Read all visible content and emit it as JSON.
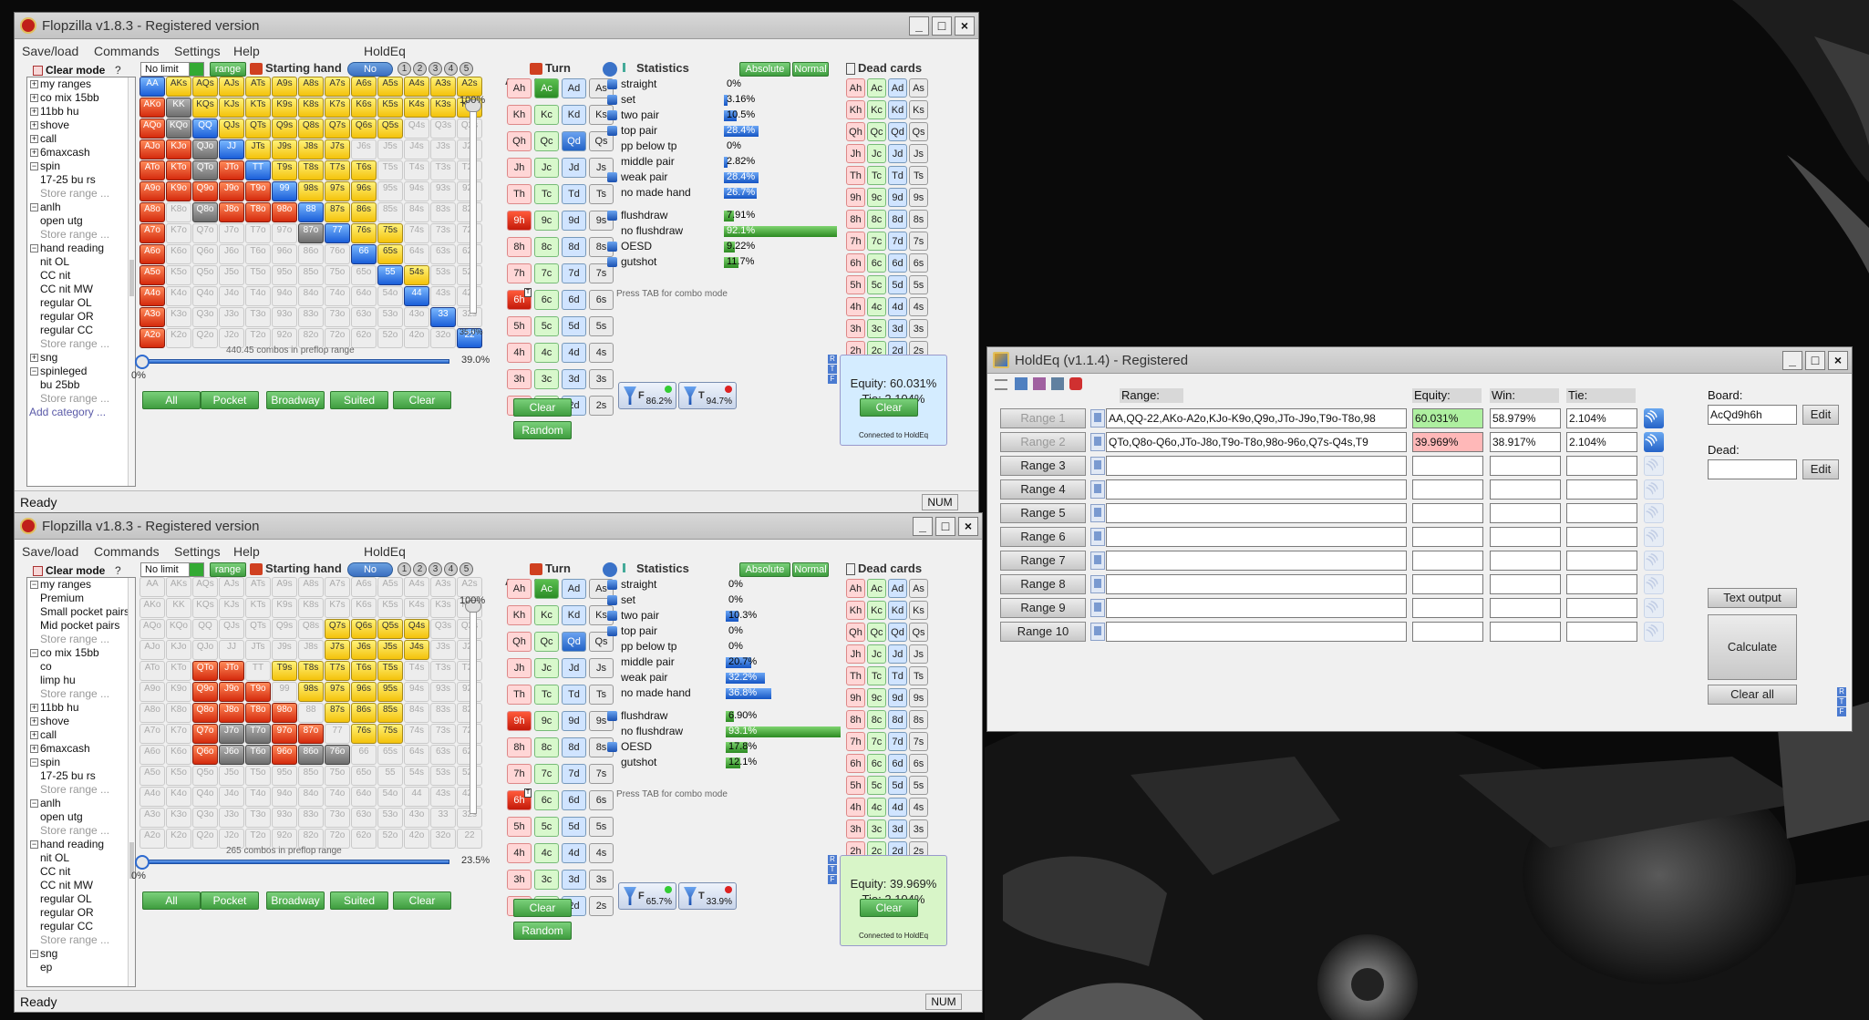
{
  "flopzilla_top": {
    "title": "Flopzilla v1.8.3 - Registered version",
    "menu": [
      "Save/load",
      "Commands",
      "Settings",
      "Help",
      "HoldEq"
    ],
    "clear_mode": "Clear mode",
    "tree": [
      {
        "k": "c",
        "t": "my ranges"
      },
      {
        "k": "c",
        "t": "co mix 15bb"
      },
      {
        "k": "c",
        "t": "11bb hu"
      },
      {
        "k": "c",
        "t": "shove"
      },
      {
        "k": "c",
        "t": "call"
      },
      {
        "k": "c",
        "t": "6maxcash"
      },
      {
        "k": "o",
        "t": "spin"
      },
      {
        "k": "i",
        "t": "17-25 bu rs"
      },
      {
        "k": "s",
        "t": "Store range ..."
      },
      {
        "k": "o",
        "t": "anlh"
      },
      {
        "k": "i",
        "t": "open utg"
      },
      {
        "k": "s",
        "t": "Store range ..."
      },
      {
        "k": "o",
        "t": "hand reading"
      },
      {
        "k": "i",
        "t": "nit OL"
      },
      {
        "k": "i",
        "t": "CC nit"
      },
      {
        "k": "i",
        "t": "CC nit MW"
      },
      {
        "k": "i",
        "t": "regular OL"
      },
      {
        "k": "i",
        "t": "regular OR"
      },
      {
        "k": "i",
        "t": "regular CC"
      },
      {
        "k": "s",
        "t": "Store range ..."
      },
      {
        "k": "c",
        "t": "sng"
      },
      {
        "k": "o",
        "t": "spinleged"
      },
      {
        "k": "i",
        "t": "bu 25bb"
      },
      {
        "k": "s",
        "t": "Store range ..."
      },
      {
        "k": "a",
        "t": "Add category ..."
      }
    ],
    "limit": "No limit",
    "range_btn": "range",
    "starting_hand": "Starting hand",
    "no_weight": "No weight",
    "pct_top": "100%",
    "pct_mid": "35.0%",
    "pct_zero": "0%",
    "pct_slider": "39.0%",
    "combos": "440.45 combos in preflop range",
    "buttons": [
      "All",
      "Pocket",
      "Broadway",
      "Suited",
      "Clear"
    ],
    "turn_title": "Turn",
    "turn_buttons": [
      "Clear",
      "Random"
    ],
    "stats_title": "Statistics",
    "absolute": "Absolute",
    "normal": "Normal",
    "stats": [
      {
        "n": "straight",
        "f": true,
        "v": "0%",
        "p": 0,
        "c": "bl"
      },
      {
        "n": "set",
        "f": true,
        "v": "3.16%",
        "p": 3.16,
        "c": "bl"
      },
      {
        "n": "two pair",
        "f": true,
        "v": "10.5%",
        "p": 10.5,
        "c": "bl"
      },
      {
        "n": "top pair",
        "f": true,
        "v": "28.4%",
        "p": 28.4,
        "c": "bl"
      },
      {
        "n": "pp below tp",
        "f": false,
        "v": "0%",
        "p": 0,
        "c": "bl"
      },
      {
        "n": "middle pair",
        "f": false,
        "v": "2.82%",
        "p": 2.82,
        "c": "bl"
      },
      {
        "n": "weak pair",
        "f": true,
        "v": "28.4%",
        "p": 28.4,
        "c": "bl"
      },
      {
        "n": "no made hand",
        "f": false,
        "v": "26.7%",
        "p": 26.7,
        "c": "bl"
      },
      {
        "n": "flushdraw",
        "f": true,
        "v": "7.91%",
        "p": 7.91,
        "c": "gr",
        "gap": true
      },
      {
        "n": "no flushdraw",
        "f": false,
        "v": "92.1%",
        "p": 92.1,
        "c": "gr"
      },
      {
        "n": "OESD",
        "f": true,
        "v": "9.22%",
        "p": 9.22,
        "c": "gr"
      },
      {
        "n": "gutshot",
        "f": true,
        "v": "11.7%",
        "p": 11.7,
        "c": "gr"
      }
    ],
    "press_tab": "Press TAB for combo mode",
    "dead_title": "Dead cards",
    "equity": "Equity: 60.031%",
    "tie": "Tie: 2.104%",
    "connected": "Connected to HoldEq",
    "eq_clear": "Clear",
    "f_val": "86.2%",
    "t_val": "94.7%",
    "status": "Ready",
    "num": "NUM"
  },
  "flopzilla_bottom": {
    "title": "Flopzilla v1.8.3 - Registered version",
    "menu": [
      "Save/load",
      "Commands",
      "Settings",
      "Help",
      "HoldEq"
    ],
    "clear_mode": "Clear mode",
    "tree": [
      {
        "k": "o",
        "t": "my ranges"
      },
      {
        "k": "i",
        "t": "Premium"
      },
      {
        "k": "i",
        "t": "Small pocket pairs"
      },
      {
        "k": "i",
        "t": "Mid pocket pairs"
      },
      {
        "k": "s",
        "t": "Store range ..."
      },
      {
        "k": "o",
        "t": "co mix 15bb"
      },
      {
        "k": "i",
        "t": "co"
      },
      {
        "k": "i",
        "t": "limp hu"
      },
      {
        "k": "s",
        "t": "Store range ..."
      },
      {
        "k": "c",
        "t": "11bb hu"
      },
      {
        "k": "c",
        "t": "shove"
      },
      {
        "k": "c",
        "t": "call"
      },
      {
        "k": "c",
        "t": "6maxcash"
      },
      {
        "k": "o",
        "t": "spin"
      },
      {
        "k": "i",
        "t": "17-25 bu rs"
      },
      {
        "k": "s",
        "t": "Store range ..."
      },
      {
        "k": "o",
        "t": "anlh"
      },
      {
        "k": "i",
        "t": "open utg"
      },
      {
        "k": "s",
        "t": "Store range ..."
      },
      {
        "k": "o",
        "t": "hand reading"
      },
      {
        "k": "i",
        "t": "nit OL"
      },
      {
        "k": "i",
        "t": "CC nit"
      },
      {
        "k": "i",
        "t": "CC nit MW"
      },
      {
        "k": "i",
        "t": "regular OL"
      },
      {
        "k": "i",
        "t": "regular OR"
      },
      {
        "k": "i",
        "t": "regular CC"
      },
      {
        "k": "s",
        "t": "Store range ..."
      },
      {
        "k": "o",
        "t": "sng"
      },
      {
        "k": "i",
        "t": "ep"
      }
    ],
    "limit": "No limit",
    "range_btn": "range",
    "starting_hand": "Starting hand",
    "no_weight": "No weight",
    "pct_top": "100%",
    "pct_zero": "0%",
    "pct_slider": "23.5%",
    "combos": "265 combos in preflop range",
    "buttons": [
      "All",
      "Pocket",
      "Broadway",
      "Suited",
      "Clear"
    ],
    "turn_title": "Turn",
    "turn_buttons": [
      "Clear",
      "Random"
    ],
    "stats_title": "Statistics",
    "absolute": "Absolute",
    "normal": "Normal",
    "stats": [
      {
        "n": "straight",
        "f": true,
        "v": "0%",
        "p": 0,
        "c": "bl"
      },
      {
        "n": "set",
        "f": true,
        "v": "0%",
        "p": 0,
        "c": "bl"
      },
      {
        "n": "two pair",
        "f": true,
        "v": "10.3%",
        "p": 10.3,
        "c": "bl"
      },
      {
        "n": "top pair",
        "f": true,
        "v": "0%",
        "p": 0,
        "c": "bl"
      },
      {
        "n": "pp below tp",
        "f": false,
        "v": "0%",
        "p": 0,
        "c": "bl"
      },
      {
        "n": "middle pair",
        "f": false,
        "v": "20.7%",
        "p": 20.7,
        "c": "bl"
      },
      {
        "n": "weak pair",
        "f": false,
        "v": "32.2%",
        "p": 32.2,
        "c": "bl"
      },
      {
        "n": "no made hand",
        "f": false,
        "v": "36.8%",
        "p": 36.8,
        "c": "bl"
      },
      {
        "n": "flushdraw",
        "f": true,
        "v": "6.90%",
        "p": 6.9,
        "c": "gr",
        "gap": true
      },
      {
        "n": "no flushdraw",
        "f": false,
        "v": "93.1%",
        "p": 93.1,
        "c": "gr"
      },
      {
        "n": "OESD",
        "f": true,
        "v": "17.8%",
        "p": 17.8,
        "c": "gr"
      },
      {
        "n": "gutshot",
        "f": false,
        "v": "12.1%",
        "p": 12.1,
        "c": "gr"
      }
    ],
    "press_tab": "Press TAB for combo mode",
    "dead_title": "Dead cards",
    "equity": "Equity: 39.969%",
    "tie": "Tie: 2.104%",
    "connected": "Connected to HoldEq",
    "eq_clear": "Clear",
    "f_val": "65.7%",
    "t_val": "33.9%",
    "status": "Ready",
    "num": "NUM"
  },
  "grid_top": [
    [
      "b:AA",
      "y:AKs",
      "y:AQs",
      "y:AJs",
      "y:ATs",
      "y:A9s",
      "y:A8s",
      "y:A7s",
      "y:A6s",
      "y:A5s",
      "y:A4s",
      "y:A3s",
      "y:A2s"
    ],
    [
      "r:AKo",
      "g:KK",
      "y:KQs",
      "y:KJs",
      "y:KTs",
      "y:K9s",
      "y:K8s",
      "y:K7s",
      "y:K6s",
      "y:K5s",
      "y:K4s",
      "y:K3s",
      "y:K2s"
    ],
    [
      "r:AQo",
      "g:KQo",
      "b:QQ",
      "y:QJs",
      "y:QTs",
      "y:Q9s",
      "y:Q8s",
      "y:Q7s",
      "y:Q6s",
      "y:Q5s",
      "e:Q4s",
      "e:Q3s",
      "e:Q2s"
    ],
    [
      "r:AJo",
      "r:KJo",
      "g:QJo",
      "b:JJ",
      "y:JTs",
      "y:J9s",
      "y:J8s",
      "y:J7s",
      "e:J6s",
      "e:J5s",
      "e:J4s",
      "e:J3s",
      "e:J2s"
    ],
    [
      "r:ATo",
      "r:KTo",
      "g:QTo",
      "r:JTo",
      "b:TT",
      "y:T9s",
      "y:T8s",
      "y:T7s",
      "y:T6s",
      "e:T5s",
      "e:T4s",
      "e:T3s",
      "e:T2s"
    ],
    [
      "r:A9o",
      "r:K9o",
      "r:Q9o",
      "r:J9o",
      "r:T9o",
      "b:99",
      "y:98s",
      "y:97s",
      "y:96s",
      "e:95s",
      "e:94s",
      "e:93s",
      "e:92s"
    ],
    [
      "r:A8o",
      "e:K8o",
      "g:Q8o",
      "r:J8o",
      "r:T8o",
      "r:98o",
      "b:88",
      "y:87s",
      "y:86s",
      "e:85s",
      "e:84s",
      "e:83s",
      "e:82s"
    ],
    [
      "r:A7o",
      "e:K7o",
      "e:Q7o",
      "e:J7o",
      "e:T7o",
      "e:97o",
      "g:87o",
      "b:77",
      "y:76s",
      "y:75s",
      "e:74s",
      "e:73s",
      "e:72s"
    ],
    [
      "r:A6o",
      "e:K6o",
      "e:Q6o",
      "e:J6o",
      "e:T6o",
      "e:96o",
      "e:86o",
      "e:76o",
      "b:66",
      "y:65s",
      "e:64s",
      "e:63s",
      "e:62s"
    ],
    [
      "r:A5o",
      "e:K5o",
      "e:Q5o",
      "e:J5o",
      "e:T5o",
      "e:95o",
      "e:85o",
      "e:75o",
      "e:65o",
      "b:55",
      "y:54s",
      "e:53s",
      "e:52s"
    ],
    [
      "r:A4o",
      "e:K4o",
      "e:Q4o",
      "e:J4o",
      "e:T4o",
      "e:94o",
      "e:84o",
      "e:74o",
      "e:64o",
      "e:54o",
      "b:44",
      "e:43s",
      "e:42s"
    ],
    [
      "r:A3o",
      "e:K3o",
      "e:Q3o",
      "e:J3o",
      "e:T3o",
      "e:93o",
      "e:83o",
      "e:73o",
      "e:63o",
      "e:53o",
      "e:43o",
      "b:33",
      "e:32s"
    ],
    [
      "r:A2o",
      "e:K2o",
      "e:Q2o",
      "e:J2o",
      "e:T2o",
      "e:92o",
      "e:82o",
      "e:72o",
      "e:62o",
      "e:52o",
      "e:42o",
      "e:32o",
      "b:22"
    ]
  ],
  "grid_bottom": [
    [
      "e:AA",
      "e:AKs",
      "e:AQs",
      "e:AJs",
      "e:ATs",
      "e:A9s",
      "e:A8s",
      "e:A7s",
      "e:A6s",
      "e:A5s",
      "e:A4s",
      "e:A3s",
      "e:A2s"
    ],
    [
      "e:AKo",
      "e:KK",
      "e:KQs",
      "e:KJs",
      "e:KTs",
      "e:K9s",
      "e:K8s",
      "e:K7s",
      "e:K6s",
      "e:K5s",
      "e:K4s",
      "e:K3s",
      "e:K2s"
    ],
    [
      "e:AQo",
      "e:KQo",
      "e:QQ",
      "e:QJs",
      "e:QTs",
      "e:Q9s",
      "e:Q8s",
      "y:Q7s",
      "y:Q6s",
      "y:Q5s",
      "y:Q4s",
      "e:Q3s",
      "e:Q2s"
    ],
    [
      "e:AJo",
      "e:KJo",
      "e:QJo",
      "e:JJ",
      "e:JTs",
      "e:J9s",
      "e:J8s",
      "y:J7s",
      "y:J6s",
      "y:J5s",
      "y:J4s",
      "e:J3s",
      "e:J2s"
    ],
    [
      "e:ATo",
      "e:KTo",
      "r:QTo",
      "r:JTo",
      "e:TT",
      "y:T9s",
      "y:T8s",
      "y:T7s",
      "y:T6s",
      "y:T5s",
      "e:T4s",
      "e:T3s",
      "e:T2s"
    ],
    [
      "e:A9o",
      "e:K9o",
      "r:Q9o",
      "r:J9o",
      "r:T9o",
      "e:99",
      "y:98s",
      "y:97s",
      "y:96s",
      "y:95s",
      "e:94s",
      "e:93s",
      "e:92s"
    ],
    [
      "e:A8o",
      "e:K8o",
      "r:Q8o",
      "r:J8o",
      "r:T8o",
      "r:98o",
      "e:88",
      "y:87s",
      "y:86s",
      "y:85s",
      "e:84s",
      "e:83s",
      "e:82s"
    ],
    [
      "e:A7o",
      "e:K7o",
      "r:Q7o",
      "g:J7o",
      "g:T7o",
      "r:97o",
      "r:87o",
      "e:77",
      "y:76s",
      "y:75s",
      "e:74s",
      "e:73s",
      "e:72s"
    ],
    [
      "e:A6o",
      "e:K6o",
      "r:Q6o",
      "g:J6o",
      "g:T6o",
      "r:96o",
      "g:86o",
      "g:76o",
      "e:66",
      "e:65s",
      "e:64s",
      "e:63s",
      "e:62s"
    ],
    [
      "e:A5o",
      "e:K5o",
      "e:Q5o",
      "e:J5o",
      "e:T5o",
      "e:95o",
      "e:85o",
      "e:75o",
      "e:65o",
      "e:55",
      "e:54s",
      "e:53s",
      "e:52s"
    ],
    [
      "e:A4o",
      "e:K4o",
      "e:Q4o",
      "e:J4o",
      "e:T4o",
      "e:94o",
      "e:84o",
      "e:74o",
      "e:64o",
      "e:54o",
      "e:44",
      "e:43s",
      "e:42s"
    ],
    [
      "e:A3o",
      "e:K3o",
      "e:Q3o",
      "e:J3o",
      "e:T3o",
      "e:93o",
      "e:83o",
      "e:73o",
      "e:63o",
      "e:53o",
      "e:43o",
      "e:33",
      "e:32s"
    ],
    [
      "e:A2o",
      "e:K2o",
      "e:Q2o",
      "e:J2o",
      "e:T2o",
      "e:92o",
      "e:82o",
      "e:72o",
      "e:62o",
      "e:52o",
      "e:42o",
      "e:32o",
      "e:22"
    ]
  ],
  "ranks": [
    "A",
    "K",
    "Q",
    "J",
    "T",
    "9",
    "8",
    "7",
    "6",
    "5",
    "4",
    "3",
    "2"
  ],
  "holdeq": {
    "title": "HoldEq (v1.1.4) - Registered",
    "col_range": "Range:",
    "col_equity": "Equity:",
    "col_win": "Win:",
    "col_tie": "Tie:",
    "board_label": "Board:",
    "board_value": "AcQd9h6h",
    "dead_label": "Dead:",
    "edit": "Edit",
    "text_output": "Text output",
    "calculate": "Calculate",
    "clear_all": "Clear all",
    "rows": [
      {
        "label": "Range 1",
        "range": "AA,QQ-22,AKo-A2o,KJo-K9o,Q9o,JTo-J9o,T9o-T8o,98",
        "equity": "60.031%",
        "win": "58.979%",
        "tie": "2.104%"
      },
      {
        "label": "Range 2",
        "range": "QTo,Q8o-Q6o,JTo-J8o,T9o-T8o,98o-96o,Q7s-Q4s,T9",
        "equity": "39.969%",
        "win": "38.917%",
        "tie": "2.104%"
      },
      {
        "label": "Range 3",
        "range": "",
        "equity": "",
        "win": "",
        "tie": ""
      },
      {
        "label": "Range 4",
        "range": "",
        "equity": "",
        "win": "",
        "tie": ""
      },
      {
        "label": "Range 5",
        "range": "",
        "equity": "",
        "win": "",
        "tie": ""
      },
      {
        "label": "Range 6",
        "range": "",
        "equity": "",
        "win": "",
        "tie": ""
      },
      {
        "label": "Range 7",
        "range": "",
        "equity": "",
        "win": "",
        "tie": ""
      },
      {
        "label": "Range 8",
        "range": "",
        "equity": "",
        "win": "",
        "tie": ""
      },
      {
        "label": "Range 9",
        "range": "",
        "equity": "",
        "win": "",
        "tie": ""
      },
      {
        "label": "Range 10",
        "range": "",
        "equity": "",
        "win": "",
        "tie": ""
      }
    ]
  }
}
